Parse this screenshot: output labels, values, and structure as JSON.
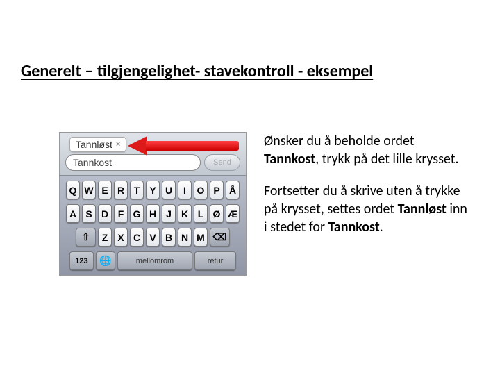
{
  "title": "Generelt – tilgjengelighet- stavekontroll - eksempel",
  "paragraphs": {
    "p1_pre": "Ønsker du å beholde ordet ",
    "p1_bold": "Tannkost",
    "p1_post": ", trykk på det lille krysset.",
    "p2_pre": "Fortsetter du å skrive uten å trykke på krysset, settes ordet ",
    "p2_bold1": "Tannløst",
    "p2_mid": " inn i stedet for ",
    "p2_bold2": "Tannkost",
    "p2_post": "."
  },
  "phone": {
    "suggestion": "Tannløst",
    "suggestion_x": "×",
    "input_value": "Tannkost",
    "send_label": "Send",
    "rows": {
      "r1": [
        "Q",
        "W",
        "E",
        "R",
        "T",
        "Y",
        "U",
        "I",
        "O",
        "P",
        "Å"
      ],
      "r2": [
        "A",
        "S",
        "D",
        "F",
        "G",
        "H",
        "J",
        "K",
        "L",
        "Ø",
        "Æ"
      ],
      "r3": [
        "Z",
        "X",
        "C",
        "V",
        "B",
        "N",
        "M"
      ],
      "num_label": "123",
      "space_label": "mellomrom",
      "return_label": "retur",
      "shift": "⇧",
      "del": "⌫",
      "globe": "🌐"
    }
  }
}
